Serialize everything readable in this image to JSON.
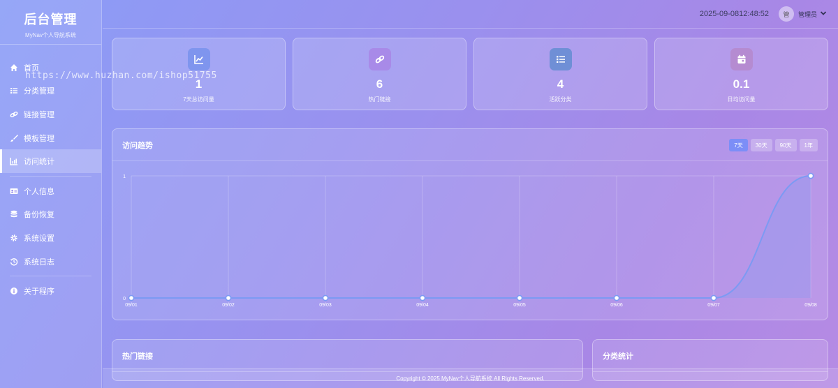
{
  "brand": {
    "title": "后台管理",
    "subtitle": "MyNav个人导航系统"
  },
  "menu": [
    {
      "label": "首页",
      "icon": "home-icon"
    },
    {
      "label": "分类管理",
      "icon": "list-icon"
    },
    {
      "label": "链接管理",
      "icon": "link-icon"
    },
    {
      "label": "模板管理",
      "icon": "brush-icon"
    },
    {
      "label": "访问统计",
      "icon": "chart-icon",
      "active": true
    },
    {
      "label": "个人信息",
      "icon": "id-card-icon"
    },
    {
      "label": "备份恢复",
      "icon": "database-icon"
    },
    {
      "label": "系统设置",
      "icon": "gear-icon"
    },
    {
      "label": "系统日志",
      "icon": "history-icon"
    },
    {
      "label": "关于程序",
      "icon": "info-icon"
    }
  ],
  "topbar": {
    "datetime": "2025-09-0812:48:52",
    "avatar_text": "管",
    "user_name": "管理员"
  },
  "stats": [
    {
      "value": "1",
      "label": "7天总访问量",
      "icon": "chart-line-icon",
      "color": "#7f95ee"
    },
    {
      "value": "6",
      "label": "热门链接",
      "icon": "link-icon",
      "color": "#a88ae8"
    },
    {
      "value": "4",
      "label": "活跃分类",
      "icon": "list-icon",
      "color": "#6f8fd6"
    },
    {
      "value": "0.1",
      "label": "日均访问量",
      "icon": "calendar-icon",
      "color": "#b58bd1"
    }
  ],
  "trend": {
    "title": "访问趋势",
    "ranges": [
      {
        "label": "7天",
        "active": true
      },
      {
        "label": "30天"
      },
      {
        "label": "90天"
      },
      {
        "label": "1年"
      }
    ]
  },
  "chart_data": {
    "type": "line",
    "categories": [
      "09/01",
      "09/02",
      "09/03",
      "09/04",
      "09/05",
      "09/06",
      "09/07",
      "09/08"
    ],
    "values": [
      0,
      0,
      0,
      0,
      0,
      0,
      0,
      1
    ],
    "ylim": [
      0,
      1
    ],
    "yticks": [
      "0",
      "1"
    ],
    "grid": true,
    "color": "#7c9af3"
  },
  "hot_links": {
    "title": "热门链接"
  },
  "category_stats": {
    "title": "分类统计"
  },
  "footer": {
    "text": "Copyright © 2025 MyNav个人导航系统 All Rights Reserved."
  },
  "watermark": "https://www.huzhan.com/ishop51755"
}
